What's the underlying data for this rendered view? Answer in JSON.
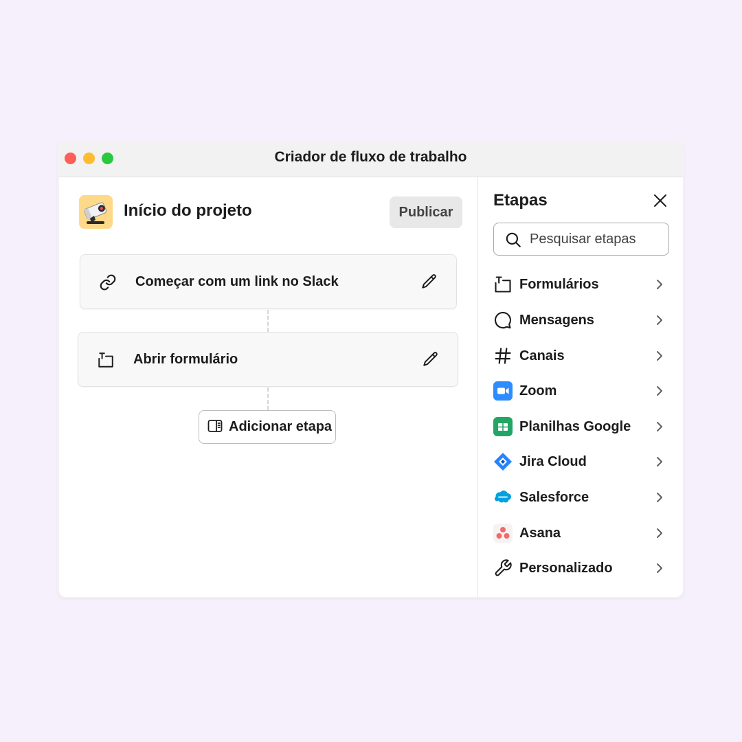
{
  "window": {
    "title": "Criador de fluxo de trabalho"
  },
  "workflow": {
    "title": "Início do projeto",
    "publish_label": "Publicar",
    "steps": [
      {
        "label": "Começar com um link no Slack",
        "icon": "link-icon"
      },
      {
        "label": "Abrir formulário",
        "icon": "form-icon"
      }
    ],
    "add_step_label": "Adicionar etapa"
  },
  "steps_panel": {
    "title": "Etapas",
    "search_placeholder": "Pesquisar etapas",
    "categories": [
      {
        "label": "Formulários",
        "icon": "form-icon"
      },
      {
        "label": "Mensagens",
        "icon": "message-bubble-icon"
      },
      {
        "label": "Canais",
        "icon": "hash-icon"
      },
      {
        "label": "Zoom",
        "icon": "zoom-icon"
      },
      {
        "label": "Planilhas Google",
        "icon": "google-sheets-icon"
      },
      {
        "label": "Jira Cloud",
        "icon": "jira-icon"
      },
      {
        "label": "Salesforce",
        "icon": "salesforce-icon"
      },
      {
        "label": "Asana",
        "icon": "asana-icon"
      },
      {
        "label": "Personalizado",
        "icon": "wrench-icon"
      }
    ]
  },
  "colors": {
    "background": "#f6f0fc",
    "close_dot": "#fe5f57",
    "minimize_dot": "#febc2e",
    "zoom_dot": "#28c840",
    "zoom_brand": "#2d8cff",
    "sheets_brand": "#23a566",
    "jira_brand": "#2684ff",
    "salesforce_brand": "#00a1e0",
    "asana_brand": "#f06a6a"
  }
}
